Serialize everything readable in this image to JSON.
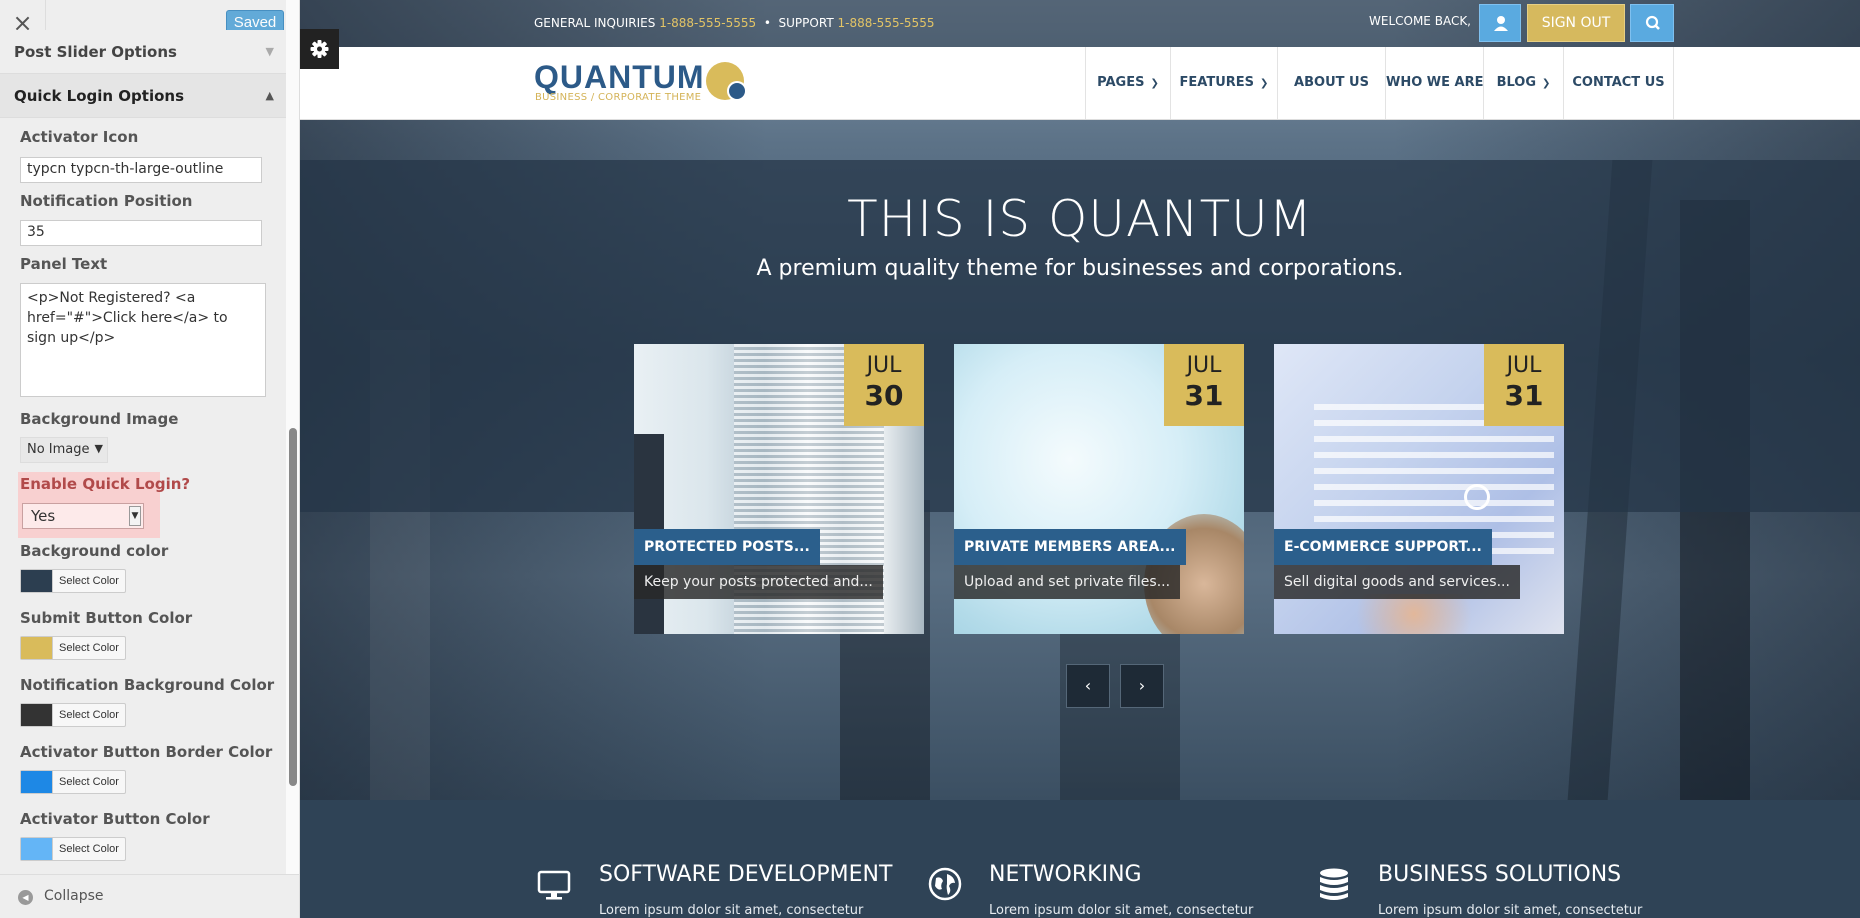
{
  "customizer": {
    "close_symbol": "×",
    "saved_label": "Saved",
    "sections": {
      "post_slider": "Post Slider Options",
      "quick_login": "Quick Login Options"
    },
    "fields": {
      "activator_icon": {
        "label": "Activator Icon",
        "value": "typcn typcn-th-large-outline"
      },
      "notification_position": {
        "label": "Notification Position",
        "value": "35"
      },
      "panel_text": {
        "label": "Panel Text",
        "value": "<p>Not Registered? <a href=\"#\">Click here</a> to sign up</p>"
      },
      "background_image": {
        "label": "Background Image",
        "value": "No Image"
      },
      "enable_quick_login": {
        "label": "Enable Quick Login?",
        "value": "Yes"
      }
    },
    "color_fields": [
      {
        "label": "Background color",
        "button": "Select Color",
        "color": "#2c3e50"
      },
      {
        "label": "Submit Button Color",
        "button": "Select Color",
        "color": "#d9bb5b"
      },
      {
        "label": "Notification Background Color",
        "button": "Select Color",
        "color": "#333333"
      },
      {
        "label": "Activator Button Border Color",
        "button": "Select Color",
        "color": "#1e88e5"
      },
      {
        "label": "Activator Button Color",
        "button": "Select Color",
        "color": "#64b5f6"
      }
    ],
    "collapse_label": "Collapse"
  },
  "site": {
    "topbar": {
      "general_label": "GENERAL INQUIRIES",
      "general_phone": "1-888-555-5555",
      "separator": "•",
      "support_label": "SUPPORT",
      "support_phone": "1-888-555-5555",
      "welcome": "WELCOME BACK,",
      "signout": "SIGN OUT"
    },
    "logo": {
      "name": "QUANTUM",
      "tagline": "BUSINESS / CORPORATE THEME"
    },
    "nav": [
      {
        "label": "PAGES",
        "has_dropdown": true
      },
      {
        "label": "FEATURES",
        "has_dropdown": true
      },
      {
        "label": "ABOUT US",
        "has_dropdown": false
      },
      {
        "label": "WHO WE ARE",
        "has_dropdown": false
      },
      {
        "label": "BLOG",
        "has_dropdown": true
      },
      {
        "label": "CONTACT US",
        "has_dropdown": false
      }
    ],
    "hero": {
      "title": "THIS IS QUANTUM",
      "subtitle": "A premium quality theme for businesses and corporations."
    },
    "cards": [
      {
        "month": "JUL",
        "day": "30",
        "title": "PROTECTED POSTS...",
        "excerpt": "Keep your posts protected and..."
      },
      {
        "month": "JUL",
        "day": "31",
        "title": "PRIVATE MEMBERS AREA...",
        "excerpt": "Upload and set private files..."
      },
      {
        "month": "JUL",
        "day": "31",
        "title": "E-COMMERCE SUPPORT...",
        "excerpt": "Sell digital goods and services..."
      }
    ],
    "slider": {
      "prev": "‹",
      "next": "›"
    },
    "services": [
      {
        "icon": "monitor-icon",
        "title": "SOFTWARE DEVELOPMENT",
        "text": "Lorem ipsum dolor sit amet, consectetur"
      },
      {
        "icon": "globe-icon",
        "title": "NETWORKING",
        "text": "Lorem ipsum dolor sit amet, consectetur"
      },
      {
        "icon": "database-icon",
        "title": "BUSINESS SOLUTIONS",
        "text": "Lorem ipsum dolor sit amet, consectetur"
      }
    ],
    "colors": {
      "accent_gold": "#d9bb5b",
      "accent_blue": "#2b5f8c",
      "button_blue": "#5aaae0"
    }
  }
}
